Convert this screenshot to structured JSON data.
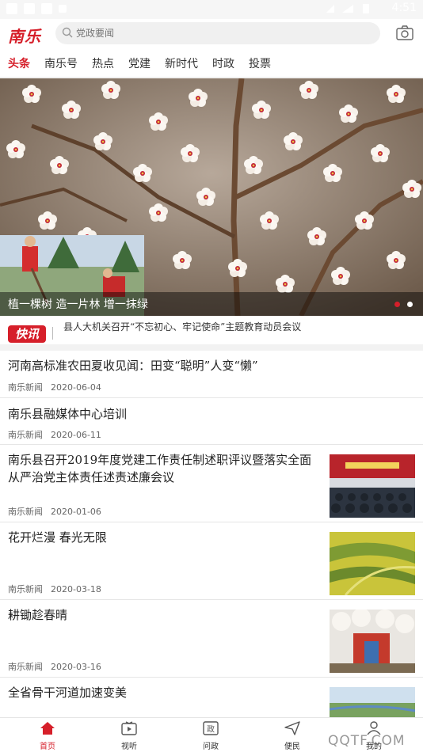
{
  "status_bar": {
    "time": "4:51"
  },
  "header": {
    "logo": "南乐",
    "search_placeholder": "党政要闻"
  },
  "tabs": [
    "头条",
    "南乐号",
    "热点",
    "党建",
    "新时代",
    "时政",
    "投票"
  ],
  "banner": {
    "caption": "植一棵树 造一片林 增一抹绿",
    "slides": 2,
    "active_slide": 1
  },
  "flash": {
    "badge": "快讯",
    "text": "县人大机关召开“不忘初心、牢记使命”主题教育动员会议"
  },
  "news": [
    {
      "title": "河南高标准农田夏收见闻：田变“聪明”人变“懒”",
      "source": "南乐新闻",
      "date": "2020-06-04",
      "thumb": false
    },
    {
      "title": "南乐县融媒体中心培训",
      "source": "南乐新闻",
      "date": "2020-06-11",
      "thumb": false
    },
    {
      "title": "南乐县召开2019年度党建工作责任制述职评议暨落实全面从严治党主体责任述责述廉会议",
      "source": "南乐新闻",
      "date": "2020-01-06",
      "thumb": true
    },
    {
      "title": "花开烂漫 春光无限",
      "source": "南乐新闻",
      "date": "2020-03-18",
      "thumb": true
    },
    {
      "title": "耕锄趁春晴",
      "source": "南乐新闻",
      "date": "2020-03-16",
      "thumb": true
    },
    {
      "title": "全省骨干河道加速变美",
      "source": "",
      "date": "",
      "thumb": true
    }
  ],
  "bottom_nav": [
    {
      "label": "首页",
      "icon": "home-icon",
      "active": true
    },
    {
      "label": "视听",
      "icon": "tv-icon",
      "active": false
    },
    {
      "label": "问政",
      "icon": "zheng-icon",
      "active": false
    },
    {
      "label": "便民",
      "icon": "send-icon",
      "active": false
    },
    {
      "label": "我的",
      "icon": "user-icon",
      "active": false
    }
  ],
  "watermark": "QQTF.COM",
  "colors": {
    "accent": "#d61f2a"
  }
}
